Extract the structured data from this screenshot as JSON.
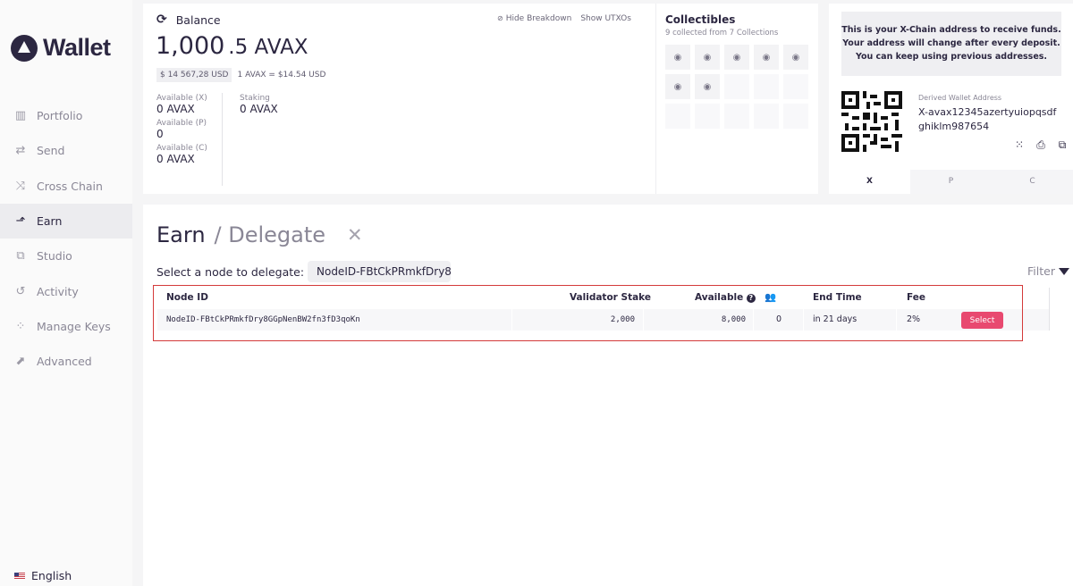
{
  "sidebar": {
    "logo_text": "Wallet",
    "items": [
      {
        "label": "Portfolio",
        "icon": "portfolio-icon",
        "glyph": "▥"
      },
      {
        "label": "Send",
        "icon": "send-icon",
        "glyph": "⇄"
      },
      {
        "label": "Cross Chain",
        "icon": "cross-chain-icon",
        "glyph": "⤨"
      },
      {
        "label": "Earn",
        "icon": "earn-icon",
        "glyph": "⬏"
      },
      {
        "label": "Studio",
        "icon": "studio-icon",
        "glyph": "⧉"
      },
      {
        "label": "Activity",
        "icon": "activity-icon",
        "glyph": "↺"
      },
      {
        "label": "Manage Keys",
        "icon": "manage-keys-icon",
        "glyph": "⁘"
      },
      {
        "label": "Advanced",
        "icon": "advanced-icon",
        "glyph": "⬈"
      }
    ],
    "active": "Earn",
    "language": "English"
  },
  "balance": {
    "title": "Balance",
    "total_int": "1,000",
    "total_dec": ".5 AVAX",
    "usd": "$ 14 567,28 USD",
    "rate": "1 AVAX = $14.54 USD",
    "hide_breakdown": "Hide Breakdown",
    "show_utxos": "Show UTXOs",
    "available_x_label": "Available (X)",
    "available_x": "0 AVAX",
    "available_p_label": "Available (P)",
    "available_p": "0",
    "available_c_label": "Available (C)",
    "available_c": "0 AVAX",
    "staking_label": "Staking",
    "staking": "0 AVAX"
  },
  "collectibles": {
    "title": "Collectibles",
    "subtitle": "9 collected from 7 Collections",
    "visible_count": 7,
    "total_slots": 15
  },
  "address": {
    "note_line1": "This is your X-Chain address to receive funds.",
    "note_line2": "Your address will change after every deposit.",
    "note_line3": "You can keep using previous addresses.",
    "label": "Derived Wallet Address",
    "value": "X-avax12345azertyuiopqsdfghiklm987654",
    "tabs": [
      "X",
      "P",
      "C"
    ],
    "active_tab": "X"
  },
  "earn": {
    "title": "Earn",
    "subtitle": "/ Delegate",
    "select_label": "Select a node to delegate:",
    "node_input_value": "NodeID-FBtCkPRmkfDry8",
    "filter_label": "Filter",
    "columns": {
      "node_id": "Node ID",
      "validator_stake": "Validator Stake",
      "available": "Available",
      "end_time": "End Time",
      "fee": "Fee"
    },
    "rows": [
      {
        "node_id": "NodeID-FBtCkPRmkfDry8GGpNenBW2fn3fD3qoKn",
        "validator_stake": "2,000",
        "available": "8,000",
        "delegators": "0",
        "end_time": "in 21 days",
        "fee": "2%",
        "action": "Select"
      }
    ]
  },
  "colors": {
    "primary_text": "#2c2741",
    "accent_button": "#e84970",
    "highlight_border": "#d43a3a"
  }
}
